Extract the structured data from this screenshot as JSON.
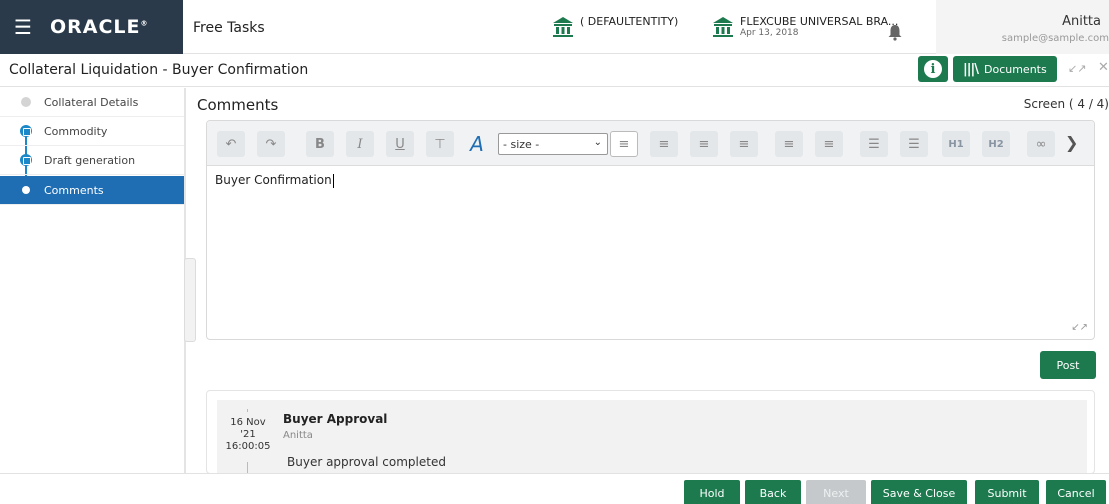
{
  "header": {
    "brand": "ORACLE",
    "app_title": "Free Tasks",
    "entity": "( DEFAULTENTITY)",
    "branch_name": "FLEXCUBE UNIVERSAL BRA...",
    "branch_date": "Apr 13, 2018",
    "user_name": "Anitta",
    "user_email": "sample@sample.com"
  },
  "titlebar": {
    "page_title": "Collateral Liquidation - Buyer Confirmation",
    "documents_label": "Documents"
  },
  "sidebar": {
    "items": [
      {
        "label": "Collateral Details",
        "state": "pending"
      },
      {
        "label": "Commodity",
        "state": "done"
      },
      {
        "label": "Draft generation",
        "state": "done"
      },
      {
        "label": "Comments",
        "state": "active"
      }
    ]
  },
  "main": {
    "section_title": "Comments",
    "screen_count": "Screen ( 4 / 4)",
    "editor": {
      "size_option": "- size -",
      "h1": "H1",
      "h2": "H2",
      "content": "Buyer Confirmation"
    },
    "post_label": "Post",
    "comments": [
      {
        "date_day": "16 Nov",
        "date_year": "'21",
        "time": "16:00:05",
        "title": "Buyer Approval",
        "user": "Anitta",
        "text": "Buyer approval completed"
      }
    ]
  },
  "footer": {
    "hold": "Hold",
    "back": "Back",
    "next": "Next",
    "save_close": "Save & Close",
    "submit": "Submit",
    "cancel": "Cancel"
  },
  "colors": {
    "brand_bg": "#2b3a4a",
    "primary_green": "#1d7a4f",
    "active_blue": "#1f6db2",
    "step_blue": "#1a88c9"
  }
}
